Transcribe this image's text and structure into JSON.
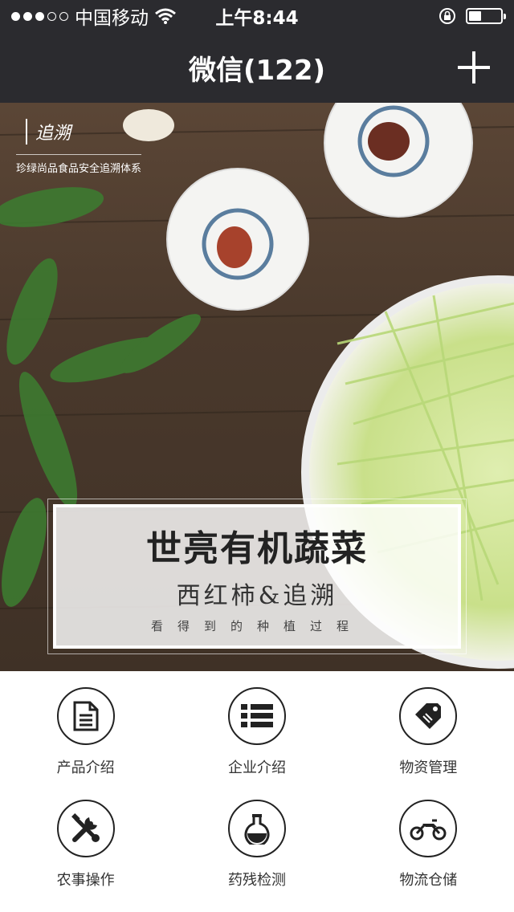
{
  "status_bar": {
    "carrier": "中国移动",
    "time": "上午8:44",
    "signal_bars_filled": 3,
    "signal_bars_total": 5,
    "battery_level": 0.4
  },
  "nav": {
    "title": "微信(122)"
  },
  "banner": {
    "brand_title": "追溯",
    "brand_subtitle": "珍绿尚品食品安全追溯体系",
    "card_title": "世亮有机蔬菜",
    "card_subtitle": "西红柿&追溯",
    "card_tagline": "看得到的种植过程"
  },
  "menu": {
    "items": [
      {
        "label": "产品介绍",
        "icon": "document-icon"
      },
      {
        "label": "企业介绍",
        "icon": "list-icon"
      },
      {
        "label": "物资管理",
        "icon": "tag-icon"
      },
      {
        "label": "农事操作",
        "icon": "tools-icon"
      },
      {
        "label": "药残检测",
        "icon": "flask-icon"
      },
      {
        "label": "物流仓储",
        "icon": "motorcycle-icon"
      }
    ]
  },
  "colors": {
    "bar_bg": "#2b2b2f",
    "icon_stroke": "#222222",
    "label_text": "#333333"
  }
}
